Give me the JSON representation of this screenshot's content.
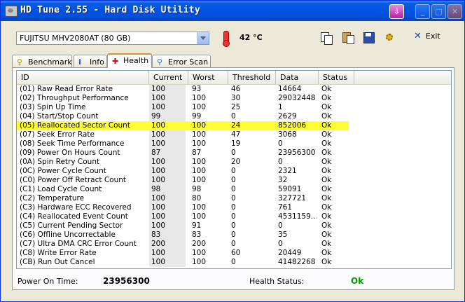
{
  "window": {
    "title": "HD Tune 2.55 - Hard Disk Utility",
    "buttons": {
      "download": "⇩",
      "minimize": "_",
      "maximize": "□",
      "close": "✕"
    }
  },
  "toolbar": {
    "drive": "FUJITSU MHV2080AT (80 GB)",
    "temperature": "42 °C",
    "temperature_icon": "thermometer-icon",
    "icons": [
      "copy-icon",
      "paste-icon",
      "save-icon",
      "options-icon"
    ],
    "exit_label": "Exit",
    "exit_icon": "close-x-icon"
  },
  "tabs": [
    {
      "label": "Benchmark",
      "icon": "benchmark-icon",
      "active": false
    },
    {
      "label": "Info",
      "icon": "info-icon",
      "active": false
    },
    {
      "label": "Health",
      "icon": "health-cross-icon",
      "active": true
    },
    {
      "label": "Error Scan",
      "icon": "magnifier-icon",
      "active": false
    }
  ],
  "table": {
    "columns": [
      "ID",
      "Current",
      "Worst",
      "Threshold",
      "Data",
      "Status"
    ],
    "selected_color": "#ffff33",
    "rows": [
      {
        "id": "(01) Raw Read Error Rate",
        "current": "100",
        "worst": "93",
        "threshold": "46",
        "data": "14664",
        "status": "Ok"
      },
      {
        "id": "(02) Throughput Performance",
        "current": "100",
        "worst": "100",
        "threshold": "30",
        "data": "29032448",
        "status": "Ok"
      },
      {
        "id": "(03) Spin Up Time",
        "current": "100",
        "worst": "100",
        "threshold": "25",
        "data": "1",
        "status": "Ok"
      },
      {
        "id": "(04) Start/Stop Count",
        "current": "99",
        "worst": "99",
        "threshold": "0",
        "data": "2629",
        "status": "Ok"
      },
      {
        "id": "(05) Reallocated Sector Count",
        "current": "100",
        "worst": "100",
        "threshold": "24",
        "data": "852006",
        "status": "Ok",
        "selected": true
      },
      {
        "id": "(07) Seek Error Rate",
        "current": "100",
        "worst": "100",
        "threshold": "47",
        "data": "3068",
        "status": "Ok"
      },
      {
        "id": "(08) Seek Time Performance",
        "current": "100",
        "worst": "100",
        "threshold": "19",
        "data": "0",
        "status": "Ok"
      },
      {
        "id": "(09) Power On Hours Count",
        "current": "87",
        "worst": "87",
        "threshold": "0",
        "data": "23956300",
        "status": "Ok"
      },
      {
        "id": "(0A) Spin Retry Count",
        "current": "100",
        "worst": "100",
        "threshold": "20",
        "data": "0",
        "status": "Ok"
      },
      {
        "id": "(0C) Power Cycle Count",
        "current": "100",
        "worst": "100",
        "threshold": "0",
        "data": "2321",
        "status": "Ok"
      },
      {
        "id": "(C0) Power Off Retract Count",
        "current": "100",
        "worst": "100",
        "threshold": "0",
        "data": "32",
        "status": "Ok"
      },
      {
        "id": "(C1) Load Cycle Count",
        "current": "98",
        "worst": "98",
        "threshold": "0",
        "data": "59091",
        "status": "Ok"
      },
      {
        "id": "(C2) Temperature",
        "current": "100",
        "worst": "80",
        "threshold": "0",
        "data": "327721",
        "status": "Ok"
      },
      {
        "id": "(C3) Hardware ECC Recovered",
        "current": "100",
        "worst": "100",
        "threshold": "0",
        "data": "761",
        "status": "Ok"
      },
      {
        "id": "(C4) Reallocated Event Count",
        "current": "100",
        "worst": "100",
        "threshold": "0",
        "data": "4531159...",
        "status": "Ok"
      },
      {
        "id": "(C5) Current Pending Sector",
        "current": "100",
        "worst": "91",
        "threshold": "0",
        "data": "0",
        "status": "Ok"
      },
      {
        "id": "(C6) Offline Uncorrectable",
        "current": "83",
        "worst": "83",
        "threshold": "0",
        "data": "35",
        "status": "Ok"
      },
      {
        "id": "(C7) Ultra DMA CRC Error Count",
        "current": "200",
        "worst": "200",
        "threshold": "0",
        "data": "0",
        "status": "Ok"
      },
      {
        "id": "(C8) Write Error Rate",
        "current": "100",
        "worst": "100",
        "threshold": "60",
        "data": "20449",
        "status": "Ok"
      },
      {
        "id": "(CB) Run Out Cancel",
        "current": "100",
        "worst": "100",
        "threshold": "0",
        "data": "41482268",
        "status": "Ok"
      }
    ]
  },
  "footer": {
    "power_on_label": "Power On Time:",
    "power_on_value": "23956300",
    "health_label": "Health Status:",
    "health_value": "Ok",
    "health_color": "#009900"
  }
}
